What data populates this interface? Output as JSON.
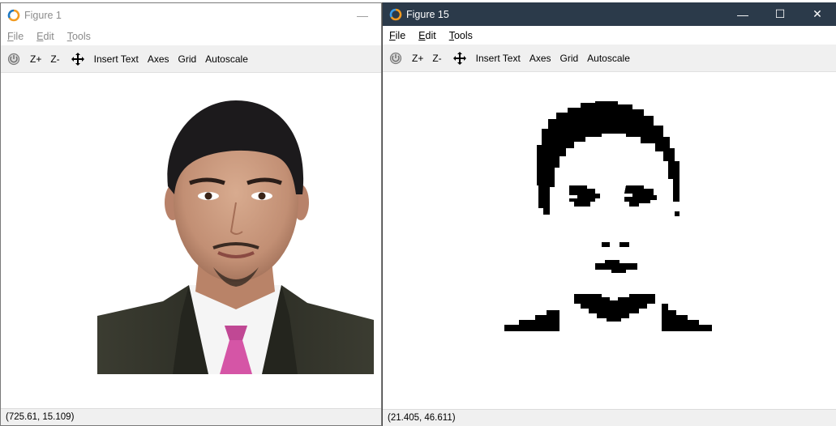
{
  "figure1": {
    "title": "Figure 1",
    "menu": [
      {
        "u": "F",
        "rest": "ile"
      },
      {
        "u": "E",
        "rest": "dit"
      },
      {
        "u": "T",
        "rest": "ools"
      }
    ],
    "toolbar": {
      "zoom_in": "Z+",
      "zoom_out": "Z-",
      "insert_text": "Insert Text",
      "axes": "Axes",
      "grid": "Grid",
      "autoscale": "Autoscale"
    },
    "minimize_symbol": "—",
    "status": "(725.61, 15.109)"
  },
  "figure15": {
    "title": "Figure 15",
    "menu": [
      {
        "u": "F",
        "rest": "ile"
      },
      {
        "u": "E",
        "rest": "dit"
      },
      {
        "u": "T",
        "rest": "ools"
      }
    ],
    "toolbar": {
      "zoom_in": "Z+",
      "zoom_out": "Z-",
      "insert_text": "Insert Text",
      "axes": "Axes",
      "grid": "Grid",
      "autoscale": "Autoscale"
    },
    "window_controls": {
      "minimize": "—",
      "maximize": "☐",
      "close": "✕"
    },
    "status": "(21.405, 46.611)"
  },
  "colors": {
    "titlebar_active": "#2b3a4a",
    "toolbar_bg": "#f0f0f0",
    "suit": "#2e2f26",
    "skin": "#c89a80",
    "hair": "#1c1a1c",
    "tie": "#d55aa8"
  }
}
